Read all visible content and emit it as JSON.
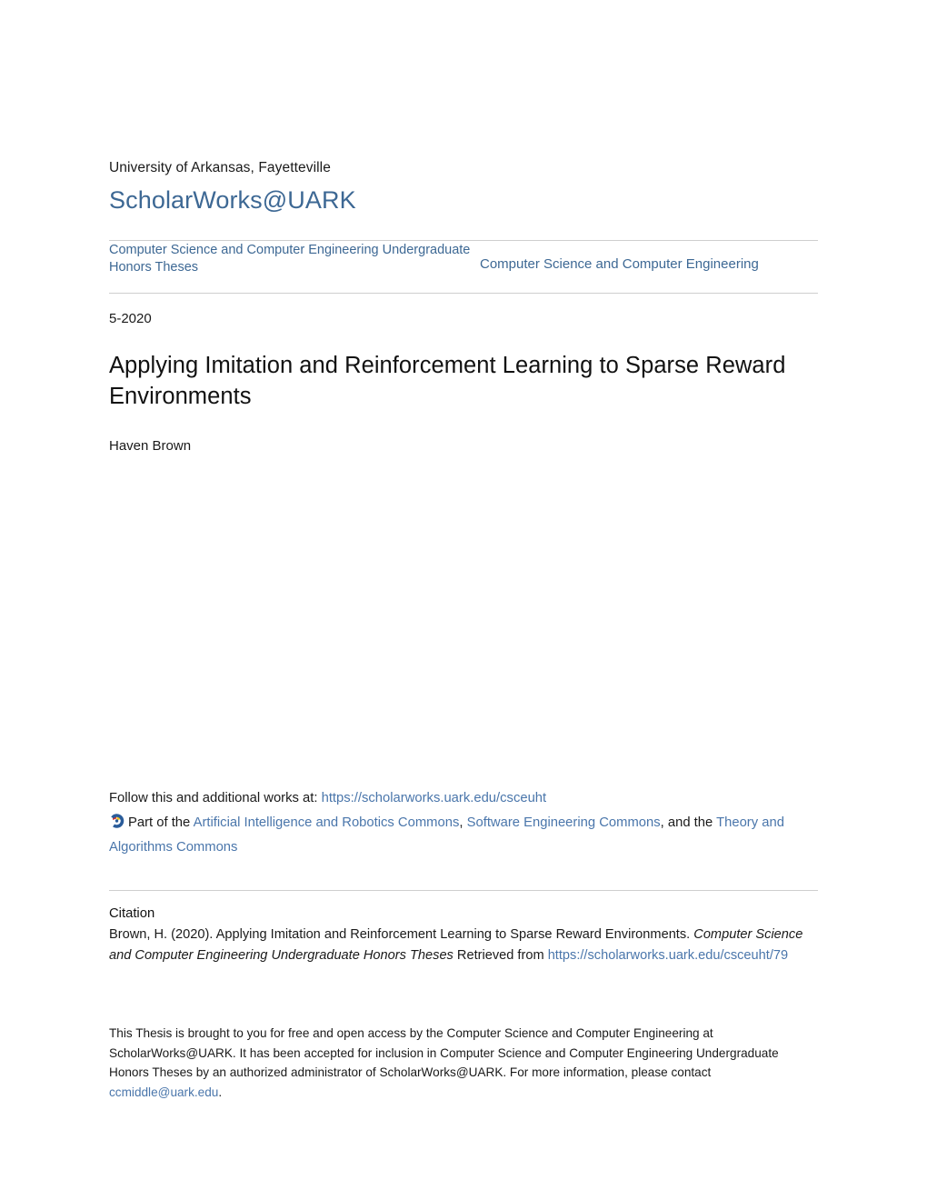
{
  "masthead": {
    "institution": "University of Arkansas, Fayetteville",
    "repository": "ScholarWorks@UARK",
    "repository_color": "#3d6894"
  },
  "series": {
    "left": "Computer Science and Computer Engineering Undergraduate Honors Theses",
    "right": "Computer Science and Computer Engineering",
    "link_color": "#3d6894"
  },
  "record": {
    "date": "5-2020",
    "title": "Applying Imitation and Reinforcement Learning to Sparse Reward Environments",
    "author": "Haven Brown"
  },
  "follow": {
    "prefix": "Follow this and additional works at:",
    "url": "https://scholarworks.uark.edu/csceuht",
    "logo_icon": "digital-commons-network-icon",
    "part_of": "Part of the",
    "commons": [
      "Artificial Intelligence and Robotics Commons",
      "Software Engineering Commons",
      "Theory and Algorithms Commons"
    ],
    "separator_1": ",",
    "separator_2": ", and the",
    "link_color": "#4a76ab"
  },
  "citation": {
    "heading": "Citation",
    "line1": "Brown, H. (2020). Applying Imitation and Reinforcement Learning to Sparse Reward Environments.",
    "italic_series": "Computer Science and Computer Engineering Undergraduate Honors Theses",
    "retrieved_from": " Retrieved from",
    "url": "https://scholarworks.uark.edu/csceuht/79"
  },
  "footer": {
    "text_part1": "This Thesis is brought to you for free and open access by the Computer Science and Computer Engineering at ScholarWorks@UARK. It has been accepted for inclusion in Computer Science and Computer Engineering Undergraduate Honors Theses by an authorized administrator of ScholarWorks@UARK. For more information, please contact ",
    "email": "ccmiddle@uark.edu",
    "text_part2": "."
  }
}
